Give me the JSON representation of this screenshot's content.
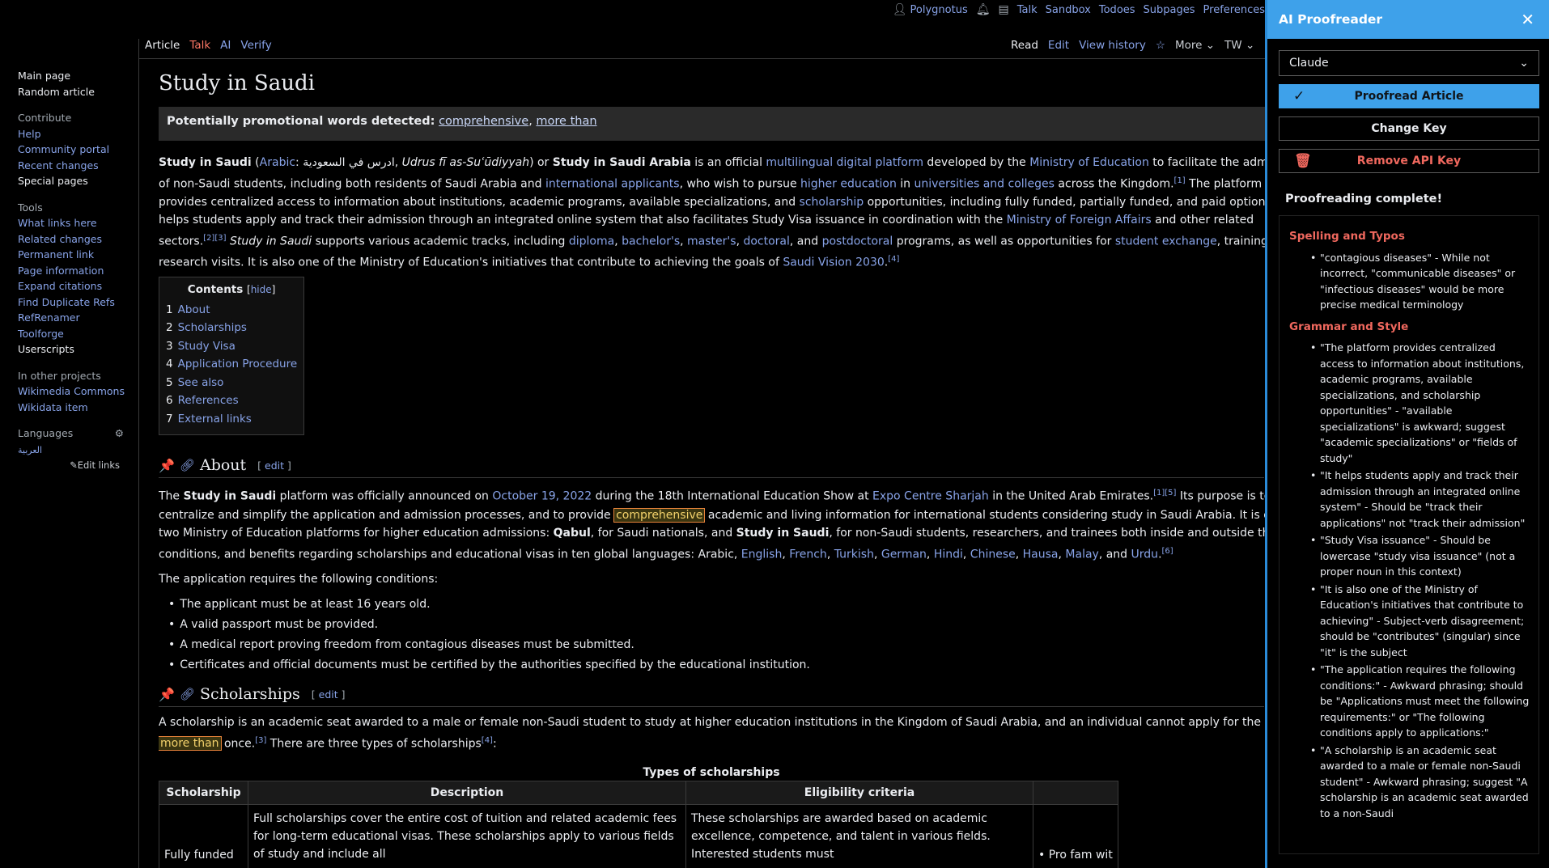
{
  "topbar": {
    "username": "Polygnotus",
    "links": [
      "Talk",
      "Sandbox",
      "Todoes",
      "Subpages",
      "Preferences"
    ]
  },
  "sidebar": {
    "nav": [
      "Main page",
      "Random article"
    ],
    "contribute_header": "Contribute",
    "contribute": [
      "Help",
      "Community portal",
      "Recent changes",
      "Special pages"
    ],
    "tools_header": "Tools",
    "tools": [
      "What links here",
      "Related changes",
      "Permanent link",
      "Page information",
      "Expand citations",
      "Find Duplicate Refs",
      "RefRenamer",
      "Toolforge",
      "Userscripts"
    ],
    "other_header": "In other projects",
    "other": [
      "Wikimedia Commons",
      "Wikidata item"
    ],
    "languages_header": "Languages",
    "language_item": "العربية",
    "edit_links": "Edit links"
  },
  "tabs": {
    "left": [
      "Article",
      "Talk",
      "AI",
      "Verify"
    ],
    "right": [
      "Read",
      "Edit",
      "View history",
      "More",
      "TW"
    ]
  },
  "article": {
    "title": "Study in Saudi",
    "banner_label": "Potentially promotional words detected:",
    "banner_words": [
      "comprehensive",
      "more than"
    ],
    "intro": {
      "l1": [
        "Study in Saudi",
        " (",
        "Arabic",
        ": ادرس في السعودية, ",
        "Udrus fī as-Suʿūdiyyah",
        ") or ",
        "Study in Saudi Arabia",
        " is an official ",
        "multilingual digital platform",
        " developed by the ",
        "Ministry of Education",
        " to facilitate the admission"
      ],
      "l2": [
        "of non-Saudi students, including both residents of Saudi Arabia and ",
        "international applicants",
        ", who wish to pursue ",
        "higher education",
        " in ",
        "universities and colleges",
        " across the Kingdom.",
        "[1]",
        " The platform"
      ],
      "l3": [
        "provides centralized access to information about institutions, academic programs, available specializations, and ",
        "scholarship",
        " opportunities, including fully funded, partially funded, and paid options. It"
      ],
      "l4": [
        "helps students apply and track their admission through an integrated online system that also facilitates Study Visa issuance in coordination with the ",
        "Ministry of Foreign Affairs",
        " and other related"
      ],
      "l5": [
        "sectors.",
        "[2][3]",
        " ",
        "Study in Saudi",
        " supports various academic tracks, including ",
        "diploma",
        ", ",
        "bachelor's",
        ", ",
        "master's",
        ", ",
        "doctoral",
        ", and ",
        "postdoctoral",
        " programs, as well as opportunities for ",
        "student exchange",
        ", training, and"
      ],
      "l6": [
        "research visits. It is also one of the Ministry of Education's initiatives that contribute to achieving the goals of ",
        "Saudi Vision 2030",
        ".",
        "[4]"
      ]
    },
    "toc": {
      "title": "Contents",
      "hide": "hide",
      "items": [
        {
          "num": "1",
          "label": "About"
        },
        {
          "num": "2",
          "label": "Scholarships"
        },
        {
          "num": "3",
          "label": "Study Visa"
        },
        {
          "num": "4",
          "label": "Application Procedure"
        },
        {
          "num": "5",
          "label": "See also"
        },
        {
          "num": "6",
          "label": "References"
        },
        {
          "num": "7",
          "label": "External links"
        }
      ]
    },
    "about": {
      "heading": "About",
      "edit": "edit",
      "l1": [
        "The ",
        "Study in Saudi",
        " platform was officially announced on ",
        "October 19, 2022",
        " during the 18th International Education Show at ",
        "Expo Centre Sharjah",
        " in the United Arab Emirates.",
        "[1][5]",
        " Its purpose is to"
      ],
      "l2": [
        "centralize and simplify the application and admission processes, and to provide ",
        "comprehensive",
        " academic and living information for international students considering study in Saudi Arabia. It is one of"
      ],
      "l3": [
        "two Ministry of Education platforms for higher education admissions: ",
        "Qabul",
        ", for Saudi nationals, and ",
        "Study in Saudi",
        ", for non-Saudi students, researchers, and trainees both inside and outside the Kingdom"
      ],
      "l4": [
        "conditions, and benefits regarding scholarships and educational visas in ten global languages: Arabic, ",
        "English",
        ", ",
        "French",
        ", ",
        "Turkish",
        ", ",
        "German",
        ", ",
        "Hindi",
        ", ",
        "Chinese",
        ", ",
        "Hausa",
        ", ",
        "Malay",
        ", and ",
        "Urdu",
        ".",
        "[6]"
      ],
      "conditions_intro": "The application requires the following conditions:",
      "conditions": [
        "The applicant must be at least 16 years old.",
        "A valid passport must be provided.",
        "A medical report proving freedom from contagious diseases must be submitted.",
        "Certificates and official documents must be certified by the authorities specified by the educational institution."
      ]
    },
    "scholarships": {
      "heading": "Scholarships",
      "edit": "edit",
      "l1": "A scholarship is an academic seat awarded to a male or female non-Saudi student to study at higher education institutions in the Kingdom of Saudi Arabia, and an individual cannot apply for the same scholarship",
      "l2": [
        "more than",
        " once.",
        "[3]",
        " There are three types of scholarships",
        "[4]",
        ":"
      ],
      "table_caption": "Types of scholarships",
      "columns": [
        "Scholarship",
        "Description",
        "Eligibility criteria"
      ],
      "row1": {
        "name": "Fully funded",
        "description": "Full scholarships cover the entire cost of tuition and related academic fees for long-term educational visas. These scholarships apply to various fields of study and include all",
        "eligibility": "These scholarships are awarded based on academic excellence, competence, and talent in various fields. Interested students must",
        "extra": "Pro fam wit"
      }
    }
  },
  "ai_panel": {
    "title": "AI Proofreader",
    "model": "Claude",
    "proofread_label": "Proofread Article",
    "change_key_label": "Change Key",
    "remove_key_label": "Remove API Key",
    "status": "Proofreading complete!",
    "sections": [
      {
        "title": "Spelling and Typos",
        "items": [
          "\"contagious diseases\" - While not incorrect, \"communicable diseases\" or \"infectious diseases\" would be more precise medical terminology"
        ]
      },
      {
        "title": "Grammar and Style",
        "items": [
          "\"The platform provides centralized access to information about institutions, academic programs, available specializations, and scholarship opportunities\" - \"available specializations\" is awkward; suggest \"academic specializations\" or \"fields of study\"",
          "\"It helps students apply and track their admission through an integrated online system\" - Should be \"track their applications\" not \"track their admission\"",
          "\"Study Visa issuance\" - Should be lowercase \"study visa issuance\" (not a proper noun in this context)",
          "\"It is also one of the Ministry of Education's initiatives that contribute to achieving\" - Subject-verb disagreement; should be \"contributes\" (singular) since \"it\" is the subject",
          "\"The application requires the following conditions:\" - Awkward phrasing; should be \"Applications must meet the following requirements:\" or \"The following conditions apply to applications:\"",
          "\"A scholarship is an academic seat awarded to a male or female non-Saudi student\" - Awkward phrasing; suggest \"A scholarship is an academic seat awarded to a non-Saudi"
        ]
      }
    ]
  }
}
